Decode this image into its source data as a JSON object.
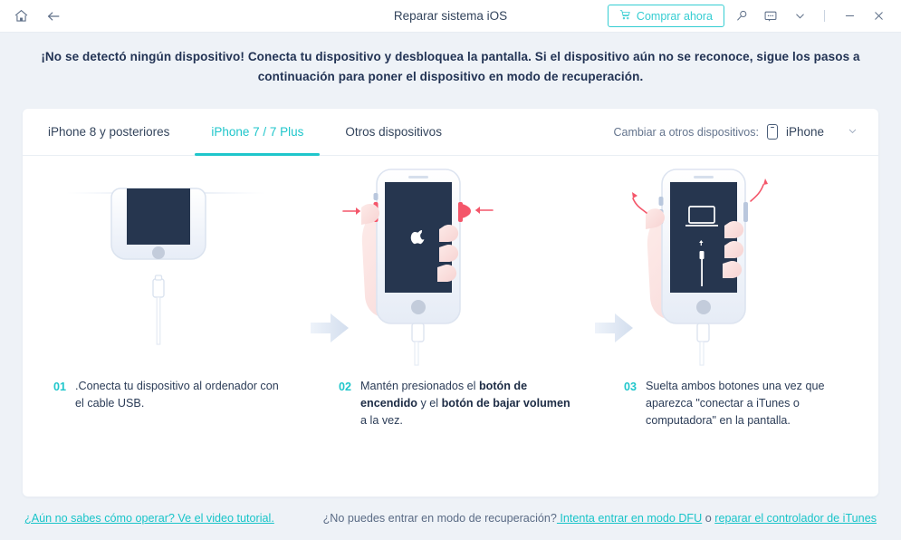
{
  "titlebar": {
    "home_icon": "home-icon",
    "back_icon": "back-arrow-icon",
    "title": "Reparar sistema iOS",
    "buy_label": "Comprar ahora",
    "cart_icon": "shopping-cart-icon",
    "search_icon": "search-icon",
    "feedback_icon": "feedback-bubble-icon",
    "chevron_icon": "chevron-down-icon",
    "minimize_icon": "minimize-icon",
    "close_icon": "close-icon"
  },
  "banner": {
    "text": "¡No se detectó ningún dispositivo! Conecta tu dispositivo y desbloquea la pantalla. Si el dispositivo aún no se reconoce, sigue los pasos a continuación para poner el dispositivo en modo de recuperación."
  },
  "tabs": [
    {
      "label": "iPhone 8 y posteriores",
      "active": false
    },
    {
      "label": "iPhone 7 / 7 Plus",
      "active": true
    },
    {
      "label": "Otros dispositivos",
      "active": false
    }
  ],
  "switcher": {
    "label": "Cambiar a otros dispositivos:",
    "value": "iPhone",
    "device_icon": "phone-icon",
    "chevron_icon": "chevron-down-icon"
  },
  "steps": [
    {
      "num": "01",
      "text_plain": ".Conecta tu dispositivo al ordenador con el cable USB.",
      "parts": [
        {
          "t": ".Conecta tu dispositivo al ordenador con el cable USB.",
          "b": false
        }
      ]
    },
    {
      "num": "02",
      "text_plain": "Mantén presionados el botón de encendido y el botón de bajar volumen a la vez.",
      "parts": [
        {
          "t": "Mantén presionados el ",
          "b": false
        },
        {
          "t": "botón de encendido",
          "b": true
        },
        {
          "t": " y el ",
          "b": false
        },
        {
          "t": "botón de bajar volumen",
          "b": true
        },
        {
          "t": " a la vez.",
          "b": false
        }
      ]
    },
    {
      "num": "03",
      "text_plain": "Suelta ambos botones una vez que aparezca \"conectar a iTunes o computadora\" en la pantalla.",
      "parts": [
        {
          "t": "Suelta ambos botones una vez que aparezca \"conectar a iTunes o computadora\" en la pantalla.",
          "b": false
        }
      ]
    }
  ],
  "footer": {
    "tutorial_link": "¿Aún no sabes cómo operar? Ve el video tutorial.",
    "recovery_question": "¿No puedes entrar en modo de recuperación?",
    "dfu_link": " Intenta entrar en modo DFU",
    "or_text": " o ",
    "itunes_link": "reparar el controlador de iTunes"
  },
  "colors": {
    "accent": "#1fc6cb",
    "text_dark": "#223354",
    "page_bg": "#eef2f7",
    "card_bg": "#ffffff",
    "arrow_gray": "#dbe4f0",
    "red": "#f4566a"
  }
}
